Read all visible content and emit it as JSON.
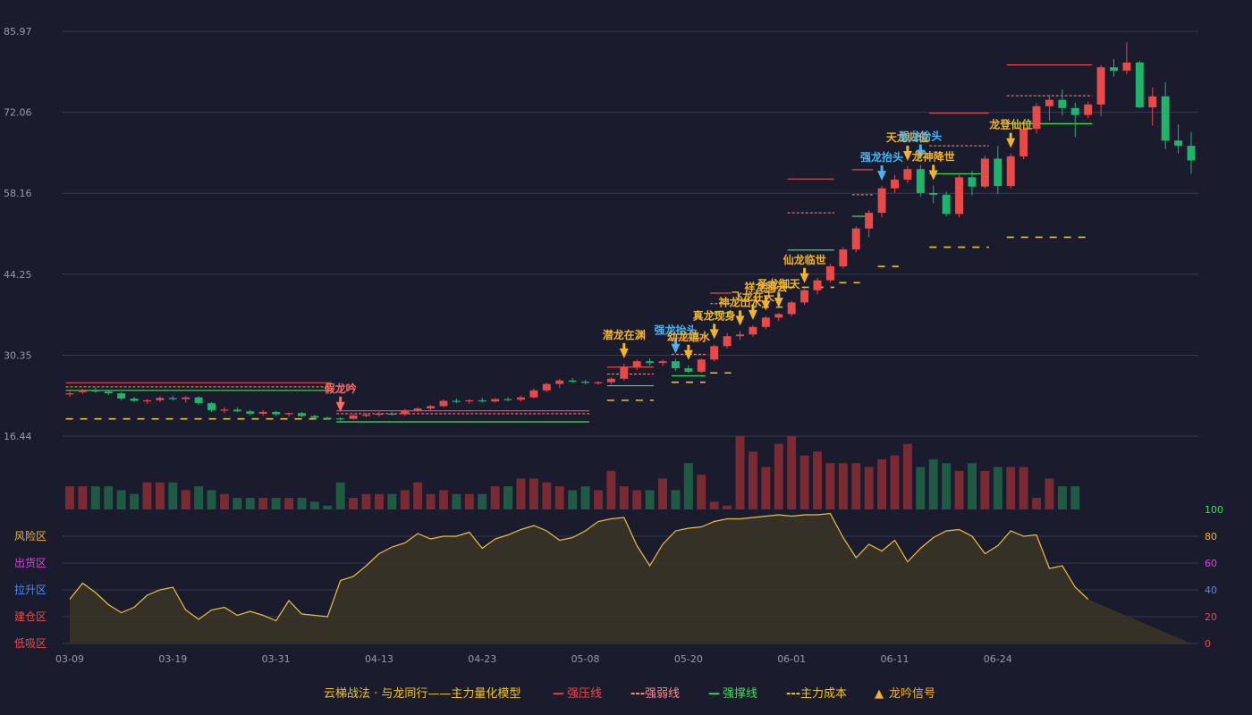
{
  "colors": {
    "background": "#1b1b2e",
    "grid": "#3a3a50",
    "axis_text": "#9a9aaa",
    "up": "#e84a4a",
    "down": "#1fb46b",
    "vol_up": "#7a2a33",
    "vol_down": "#1f5a45",
    "signal": "#f0b429",
    "signal_blue": "#4ab4f0",
    "signal_red": "#ff6a6a",
    "resistance": "#e84a4a",
    "weak": "#ff8a8a",
    "support": "#3fdc5a",
    "cost": "#f0c419",
    "osc_line": "#e8c23a",
    "osc_fill": "#3a3526"
  },
  "chart_data": {
    "type": "candlestick",
    "price_axis": {
      "ylim": [
        16.44,
        85.97
      ],
      "ticks": [
        "85.97",
        "72.06",
        "58.16",
        "44.25",
        "30.35",
        "16.44"
      ]
    },
    "dates": [
      "03-09",
      "03-19",
      "03-31",
      "04-13",
      "04-23",
      "05-08",
      "05-20",
      "06-01",
      "06-11",
      "06-24"
    ],
    "date_index": [
      0,
      8,
      16,
      24,
      32,
      40,
      48,
      56,
      64,
      72
    ],
    "ohlc": [
      [
        23.6,
        24.1,
        23.2,
        23.8
      ],
      [
        24.0,
        24.6,
        23.7,
        24.3
      ],
      [
        24.3,
        24.8,
        23.9,
        24.1
      ],
      [
        24.1,
        24.4,
        23.5,
        23.8
      ],
      [
        23.8,
        24.0,
        22.6,
        22.9
      ],
      [
        22.9,
        23.2,
        22.3,
        22.5
      ],
      [
        22.5,
        22.8,
        22.0,
        22.6
      ],
      [
        22.6,
        23.3,
        22.3,
        23.0
      ],
      [
        23.0,
        23.4,
        22.6,
        22.8
      ],
      [
        22.8,
        23.3,
        22.2,
        23.1
      ],
      [
        23.1,
        23.3,
        21.8,
        22.1
      ],
      [
        22.1,
        22.3,
        20.6,
        20.9
      ],
      [
        20.9,
        21.4,
        20.4,
        21.0
      ],
      [
        21.0,
        21.4,
        20.5,
        20.7
      ],
      [
        20.7,
        21.0,
        20.0,
        20.3
      ],
      [
        20.3,
        20.9,
        20.0,
        20.6
      ],
      [
        20.6,
        20.8,
        19.9,
        20.2
      ],
      [
        20.2,
        20.5,
        19.8,
        20.4
      ],
      [
        20.4,
        20.6,
        19.7,
        19.9
      ],
      [
        19.9,
        20.1,
        19.4,
        19.6
      ],
      [
        19.6,
        19.8,
        19.3,
        19.5
      ],
      [
        19.5,
        19.7,
        19.1,
        19.4
      ],
      [
        19.4,
        20.2,
        19.3,
        20.0
      ],
      [
        20.0,
        20.4,
        19.7,
        20.1
      ],
      [
        20.1,
        20.6,
        19.8,
        20.3
      ],
      [
        20.3,
        20.6,
        20.0,
        20.2
      ],
      [
        20.2,
        21.1,
        19.9,
        20.9
      ],
      [
        20.9,
        21.4,
        20.6,
        21.2
      ],
      [
        21.2,
        21.8,
        20.9,
        21.6
      ],
      [
        21.6,
        22.8,
        21.4,
        22.5
      ],
      [
        22.5,
        22.9,
        22.1,
        22.4
      ],
      [
        22.4,
        22.8,
        22.0,
        22.6
      ],
      [
        22.6,
        23.0,
        22.2,
        22.4
      ],
      [
        22.4,
        23.0,
        22.2,
        22.8
      ],
      [
        22.8,
        23.1,
        22.4,
        22.7
      ],
      [
        22.7,
        23.4,
        22.4,
        23.1
      ],
      [
        23.1,
        24.6,
        22.9,
        24.3
      ],
      [
        24.3,
        25.6,
        24.0,
        25.4
      ],
      [
        25.4,
        26.3,
        24.7,
        26.0
      ],
      [
        26.0,
        26.4,
        25.6,
        25.8
      ],
      [
        25.8,
        26.1,
        25.4,
        25.6
      ],
      [
        25.6,
        25.9,
        25.3,
        25.7
      ],
      [
        25.7,
        26.5,
        25.4,
        26.3
      ],
      [
        26.3,
        28.9,
        26.0,
        28.4
      ],
      [
        28.4,
        29.6,
        27.8,
        29.3
      ],
      [
        29.3,
        29.8,
        28.5,
        29.0
      ],
      [
        29.0,
        29.6,
        28.5,
        29.3
      ],
      [
        29.3,
        29.7,
        27.6,
        28.1
      ],
      [
        28.1,
        28.6,
        27.2,
        27.5
      ],
      [
        27.5,
        29.8,
        27.3,
        29.6
      ],
      [
        29.6,
        32.2,
        29.3,
        31.9
      ],
      [
        31.9,
        34.1,
        31.5,
        33.6
      ],
      [
        33.6,
        34.5,
        33.0,
        33.9
      ],
      [
        33.9,
        35.5,
        33.5,
        35.2
      ],
      [
        35.2,
        37.1,
        34.8,
        36.8
      ],
      [
        36.8,
        37.6,
        36.2,
        37.4
      ],
      [
        37.4,
        39.7,
        37.0,
        39.4
      ],
      [
        39.4,
        41.8,
        39.0,
        41.5
      ],
      [
        41.5,
        43.6,
        40.8,
        43.2
      ],
      [
        43.2,
        46.0,
        42.8,
        45.6
      ],
      [
        45.6,
        48.9,
        45.2,
        48.5
      ],
      [
        48.5,
        52.5,
        48.0,
        52.1
      ],
      [
        52.1,
        55.3,
        50.6,
        54.8
      ],
      [
        54.8,
        59.4,
        54.0,
        59.0
      ],
      [
        59.0,
        61.3,
        58.2,
        60.5
      ],
      [
        60.5,
        62.8,
        59.9,
        62.3
      ],
      [
        62.3,
        63.0,
        57.6,
        58.2
      ],
      [
        58.2,
        59.5,
        56.4,
        57.9
      ],
      [
        57.9,
        58.4,
        54.2,
        54.6
      ],
      [
        54.6,
        61.3,
        54.0,
        60.9
      ],
      [
        60.9,
        62.0,
        57.8,
        59.3
      ],
      [
        59.3,
        64.6,
        59.0,
        64.1
      ],
      [
        64.1,
        66.3,
        58.0,
        59.4
      ],
      [
        59.4,
        65.0,
        59.0,
        64.5
      ],
      [
        64.5,
        69.6,
        64.0,
        69.2
      ],
      [
        69.2,
        73.6,
        68.4,
        73.1
      ],
      [
        73.1,
        75.0,
        70.6,
        74.2
      ],
      [
        74.2,
        76.0,
        71.5,
        72.8
      ],
      [
        72.8,
        73.7,
        67.8,
        71.6
      ],
      [
        71.6,
        73.9,
        71.0,
        73.4
      ],
      [
        73.4,
        80.2,
        71.4,
        79.8
      ],
      [
        79.8,
        81.2,
        78.2,
        79.2
      ],
      [
        79.2,
        84.1,
        78.6,
        80.6
      ],
      [
        80.6,
        80.9,
        72.8,
        72.9
      ],
      [
        72.9,
        76.3,
        69.8,
        74.8
      ],
      [
        74.8,
        77.2,
        65.7,
        67.2
      ],
      [
        67.2,
        70.0,
        65.0,
        66.3
      ],
      [
        66.3,
        68.7,
        61.5,
        63.8
      ]
    ],
    "signals": [
      {
        "i": 21,
        "text": "假龙吟",
        "color": "red"
      },
      {
        "i": 43,
        "text": "潜龙在渊",
        "color": "gold"
      },
      {
        "i": 47,
        "text": "强龙抬头",
        "color": "blue"
      },
      {
        "i": 48,
        "text": "幼龙嬉水",
        "color": "gold"
      },
      {
        "i": 50,
        "text": "真龙现身",
        "color": "gold"
      },
      {
        "i": 52,
        "text": "神龙出水",
        "color": "gold"
      },
      {
        "i": 53,
        "text": "飞龙在天",
        "color": "gold"
      },
      {
        "i": 54,
        "text": "祥龙腾云",
        "color": "gold"
      },
      {
        "i": 55,
        "text": "圣龙御天",
        "color": "gold"
      },
      {
        "i": 57,
        "text": "仙龙临世",
        "color": "gold"
      },
      {
        "i": 63,
        "text": "强龙抬头",
        "color": "blue"
      },
      {
        "i": 65,
        "text": "天龙归位",
        "color": "gold"
      },
      {
        "i": 66,
        "text": "强龙抬头",
        "color": "blue"
      },
      {
        "i": 67,
        "text": "龙神降世",
        "color": "gold"
      },
      {
        "i": 73,
        "text": "龙登仙位",
        "color": "gold"
      }
    ],
    "levels": {
      "resistance": [
        [
          0,
          20,
          25.6
        ],
        [
          21,
          40,
          20.8
        ],
        [
          42,
          45,
          28.3
        ],
        [
          47,
          49,
          33.3
        ],
        [
          50,
          51,
          41.0
        ],
        [
          56,
          59,
          60.6
        ],
        [
          61,
          62,
          62.2
        ],
        [
          67,
          71,
          71.9
        ],
        [
          73,
          79,
          80.2
        ]
      ],
      "weak": [
        [
          0,
          20,
          24.9
        ],
        [
          21,
          40,
          20.3
        ],
        [
          42,
          45,
          27.1
        ],
        [
          47,
          49,
          30.5
        ],
        [
          50,
          51,
          39.2
        ],
        [
          56,
          59,
          54.8
        ],
        [
          61,
          62,
          57.9
        ],
        [
          67,
          71,
          66.3
        ],
        [
          73,
          79,
          74.9
        ]
      ],
      "support": [
        [
          0,
          20,
          24.3
        ],
        [
          21,
          40,
          18.9
        ],
        [
          42,
          45,
          25.1
        ],
        [
          47,
          49,
          26.8
        ],
        [
          50,
          51,
          37.6
        ],
        [
          56,
          59,
          48.4
        ],
        [
          61,
          62,
          54.2
        ],
        [
          67,
          71,
          61.5
        ],
        [
          73,
          79,
          70.1
        ]
      ],
      "cost": [
        [
          0,
          20,
          19.4
        ],
        [
          42,
          45,
          22.6
        ],
        [
          47,
          49,
          25.7
        ],
        [
          50,
          51,
          27.3
        ],
        [
          54,
          55,
          38.6
        ],
        [
          56,
          59,
          42.0
        ],
        [
          60,
          61,
          42.8
        ],
        [
          63,
          64,
          45.6
        ],
        [
          67,
          71,
          48.9
        ],
        [
          73,
          79,
          50.6
        ]
      ]
    },
    "volume": [
      6,
      6,
      6,
      6,
      5,
      4,
      7,
      7,
      7,
      5,
      6,
      5,
      4,
      3,
      3,
      3,
      3,
      3,
      3,
      2,
      1,
      7,
      3,
      4,
      4,
      4,
      5,
      7,
      4,
      5,
      4,
      4,
      4,
      6,
      6,
      8,
      8,
      7,
      6,
      5,
      6,
      5,
      10,
      6,
      5,
      5,
      8,
      5,
      12,
      9,
      2,
      1,
      19,
      15,
      11,
      17,
      19,
      14,
      15,
      12,
      12,
      12,
      11,
      13,
      14,
      17,
      11,
      13,
      12,
      10,
      12,
      10,
      11,
      11,
      11,
      3,
      8,
      6,
      6
    ],
    "oscillator": {
      "ylim": [
        0,
        100
      ],
      "ticks": [
        "100",
        "80",
        "60",
        "40",
        "20",
        "0"
      ],
      "zones": [
        "风险区",
        "出货区",
        "拉升区",
        "建仓区",
        "低吸区"
      ],
      "values": [
        33,
        45,
        38,
        29,
        23,
        27,
        36,
        40,
        42,
        25,
        18,
        25,
        27,
        21,
        24,
        21,
        17,
        32,
        22,
        21,
        20,
        47,
        50,
        58,
        67,
        72,
        75,
        82,
        78,
        80,
        80,
        83,
        71,
        78,
        81,
        85,
        88,
        84,
        77,
        79,
        84,
        91,
        93,
        94,
        73,
        58,
        74,
        84,
        86,
        87,
        91,
        93,
        93,
        94,
        95,
        96,
        95,
        96,
        96,
        97,
        79,
        64,
        74,
        69,
        77,
        61,
        71,
        79,
        84,
        85,
        80,
        67,
        73,
        84,
        80,
        81,
        56,
        58,
        42,
        33
      ]
    }
  },
  "legend": {
    "title": "云梯战法 · 与龙同行——主力量化模型",
    "items": [
      {
        "label": "强压线",
        "symbol": "—"
      },
      {
        "label": "强弱线",
        "symbol": "---"
      },
      {
        "label": "强撑线",
        "symbol": "—"
      },
      {
        "label": "主力成本",
        "symbol": "---"
      },
      {
        "label": "龙吟信号",
        "symbol": "▲"
      }
    ]
  }
}
